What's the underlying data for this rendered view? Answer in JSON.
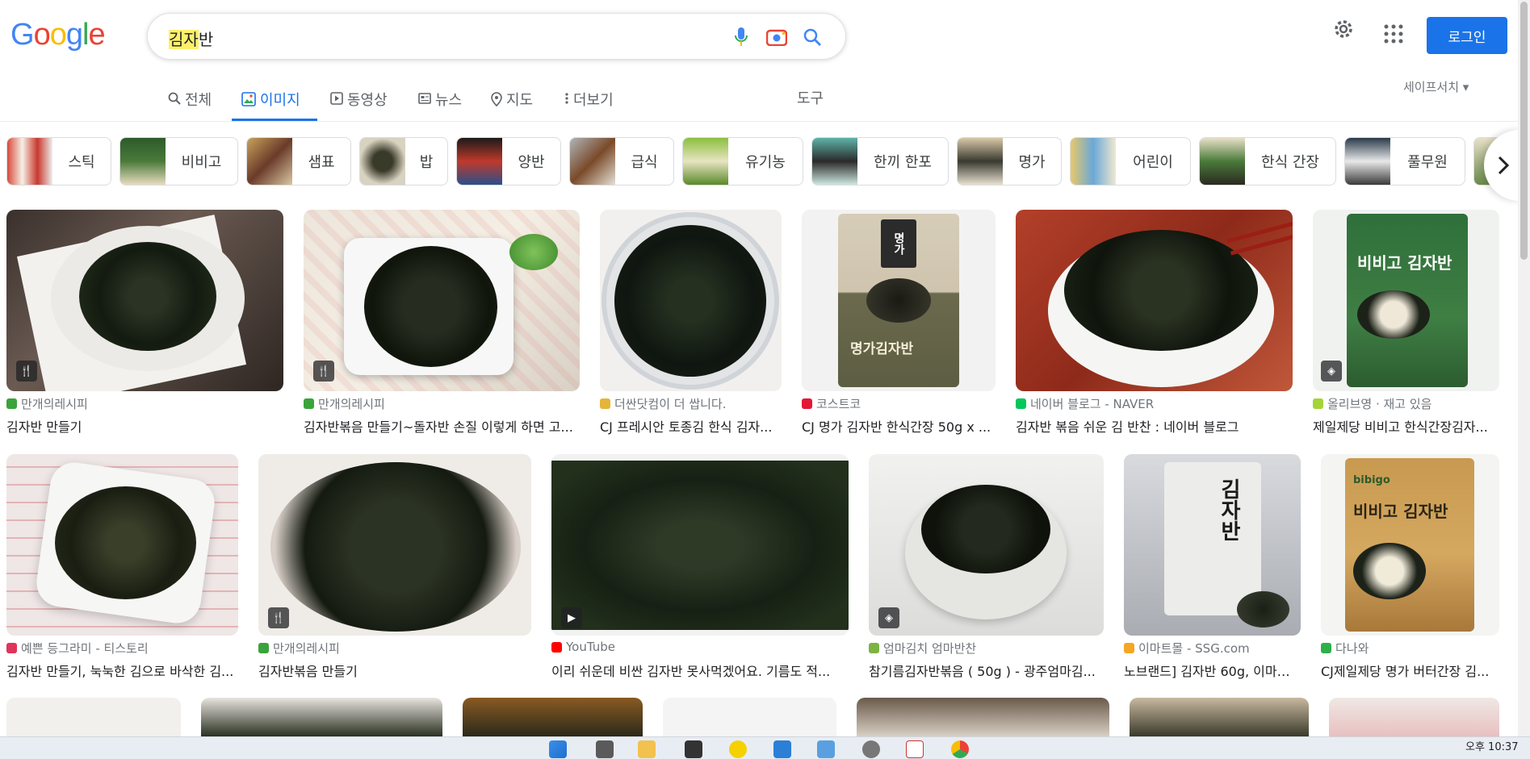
{
  "search": {
    "query_highlight": "김자",
    "query_rest": "반"
  },
  "header": {
    "logo": "Google",
    "login_label": "로그인"
  },
  "tabs": [
    {
      "label": "전체",
      "icon": "search-icon"
    },
    {
      "label": "이미지",
      "icon": "image-icon",
      "active": true
    },
    {
      "label": "동영상",
      "icon": "video-icon"
    },
    {
      "label": "뉴스",
      "icon": "news-icon"
    },
    {
      "label": "지도",
      "icon": "map-pin-icon"
    },
    {
      "label": "더보기",
      "icon": "more-vert-icon"
    }
  ],
  "tools_label": "도구",
  "safesearch_label": "세이프서치 ▾",
  "chips": [
    "스틱",
    "비비고",
    "샘표",
    "밥",
    "양반",
    "급식",
    "유기농",
    "한끼 한포",
    "명가",
    "어린이",
    "한식 간장",
    "풀무원"
  ],
  "results": [
    {
      "source": "만개의레시피",
      "title": "김자반 만들기",
      "badge": "recipe"
    },
    {
      "source": "만개의레시피",
      "title": "김자반볶음 만들기~돌자반 손질 이렇게 하면 고...",
      "badge": "recipe"
    },
    {
      "source": "더싼닷컴이 더 쌉니다.",
      "title": "CJ 프레시안 토종김 한식 김자..."
    },
    {
      "source": "코스트코",
      "title": "CJ 명가 김자반 한식간장 50g x ..."
    },
    {
      "source": "네이버 블로그 - NAVER",
      "title": "김자반 볶음 쉬운 김 반찬 : 네이버 블로그"
    },
    {
      "source": "올리브영 · 재고 있음",
      "title": "제일제당 비비고 한식간장김자...",
      "badge": "product"
    },
    {
      "source": "예쁜 등그라미 - 티스토리",
      "title": "김자반 만들기, 눅눅한 김으로 바삭한 김..."
    },
    {
      "source": "만개의레시피",
      "title": "김자반볶음 만들기",
      "badge": "recipe"
    },
    {
      "source": "YouTube",
      "title": "이리 쉬운데 비싼 김자반 못사먹겠어요. 기름도 적...",
      "badge": "video"
    },
    {
      "source": "엄마김치 엄마반찬",
      "title": "참기름김자반볶음 ( 50g ) - 광주엄마김...",
      "badge": "product"
    },
    {
      "source": "이마트몰 - SSG.com",
      "title": "노브랜드] 김자반 60g, 이마트..."
    },
    {
      "source": "다나와",
      "title": "CJ제일제당 명가 버터간장 김..."
    }
  ],
  "pouch_labels": {
    "myungga": "명가",
    "myungga_bottom": "명가김자반",
    "bibigo": "비비고 김자반",
    "bibigo_brand": "bibigo",
    "nobrand": "김자반"
  },
  "taskbar": {
    "clock": "오후 10:37"
  },
  "colors": {
    "accent": "#1a73e8",
    "seaweed": "#1c2418"
  }
}
